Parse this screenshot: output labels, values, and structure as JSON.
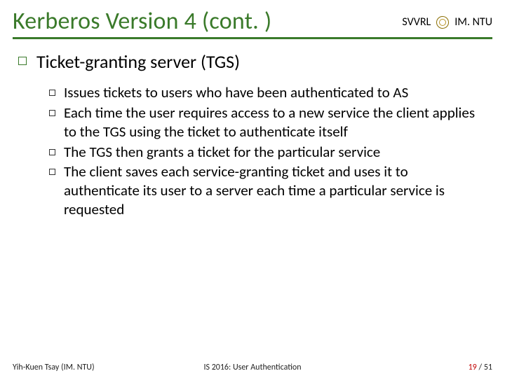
{
  "header": {
    "title": "Kerberos Version 4 (cont. )",
    "brand_left": "SVVRL",
    "brand_at": "@",
    "brand_right": "IM. NTU"
  },
  "content": {
    "main_point": "Ticket-granting server (TGS)",
    "subpoints": [
      "Issues tickets to users who have been authenticated to AS",
      "Each time the user requires access to a new service the client applies to the TGS using the ticket to authenticate itself",
      "The TGS then grants a ticket for the particular service",
      "The client saves each service-granting ticket and uses it to authenticate its user to a server each time a particular service is requested"
    ]
  },
  "footer": {
    "author": "Yih-Kuen Tsay (IM. NTU)",
    "course": "IS 2016: User Authentication",
    "page_current": "19",
    "page_sep": " / ",
    "page_total": "51"
  }
}
